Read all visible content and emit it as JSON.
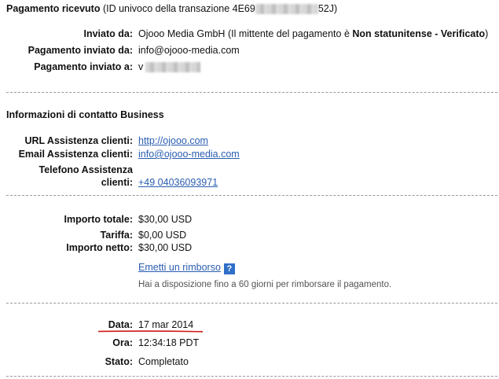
{
  "header": {
    "title": "Pagamento ricevuto",
    "id_prefix": "(ID univoco della transazione 4E69",
    "id_suffix": "52J)"
  },
  "sender": {
    "sent_by_label": "Inviato da:",
    "sent_by_name": "Ojooo Media GmbH",
    "sent_by_note_prefix": "(Il mittente del pagamento è",
    "sent_by_note_bold": "Non statunitense - Verificato",
    "sent_by_note_suffix": ")",
    "sent_from_label": "Pagamento inviato da:",
    "sent_from_value": "info@ojooo-media.com",
    "sent_to_label": "Pagamento inviato a:",
    "sent_to_value": "v"
  },
  "business": {
    "heading": "Informazioni di contatto Business",
    "url_label": "URL Assistenza clienti:",
    "url_value": "http://ojooo.com",
    "email_label": "Email Assistenza clienti:",
    "email_value": "info@ojooo-media.com",
    "phone_label_line1": "Telefono Assistenza",
    "phone_label_line2": "clienti:",
    "phone_value": "+49 04036093971"
  },
  "amounts": {
    "total_label": "Importo totale:",
    "total_value": "$30,00 USD",
    "fee_label": "Tariffa:",
    "fee_value": "$0,00 USD",
    "net_label": "Importo netto:",
    "net_value": "$30,00 USD",
    "refund_link": "Emetti un rimborso",
    "refund_help_icon": "?",
    "refund_note": "Hai a disposizione fino a 60 giorni per rimborsare il pagamento."
  },
  "details": {
    "date_label": "Data:",
    "date_value": "17 mar 2014",
    "time_label": "Ora:",
    "time_value": "12:34:18 PDT",
    "status_label": "Stato:",
    "status_value": "Completato"
  },
  "colors": {
    "link": "#2a5db0",
    "help_icon": "#2f6fc8",
    "annotation_line": "#d01818",
    "separator": "#9a9a9a"
  }
}
